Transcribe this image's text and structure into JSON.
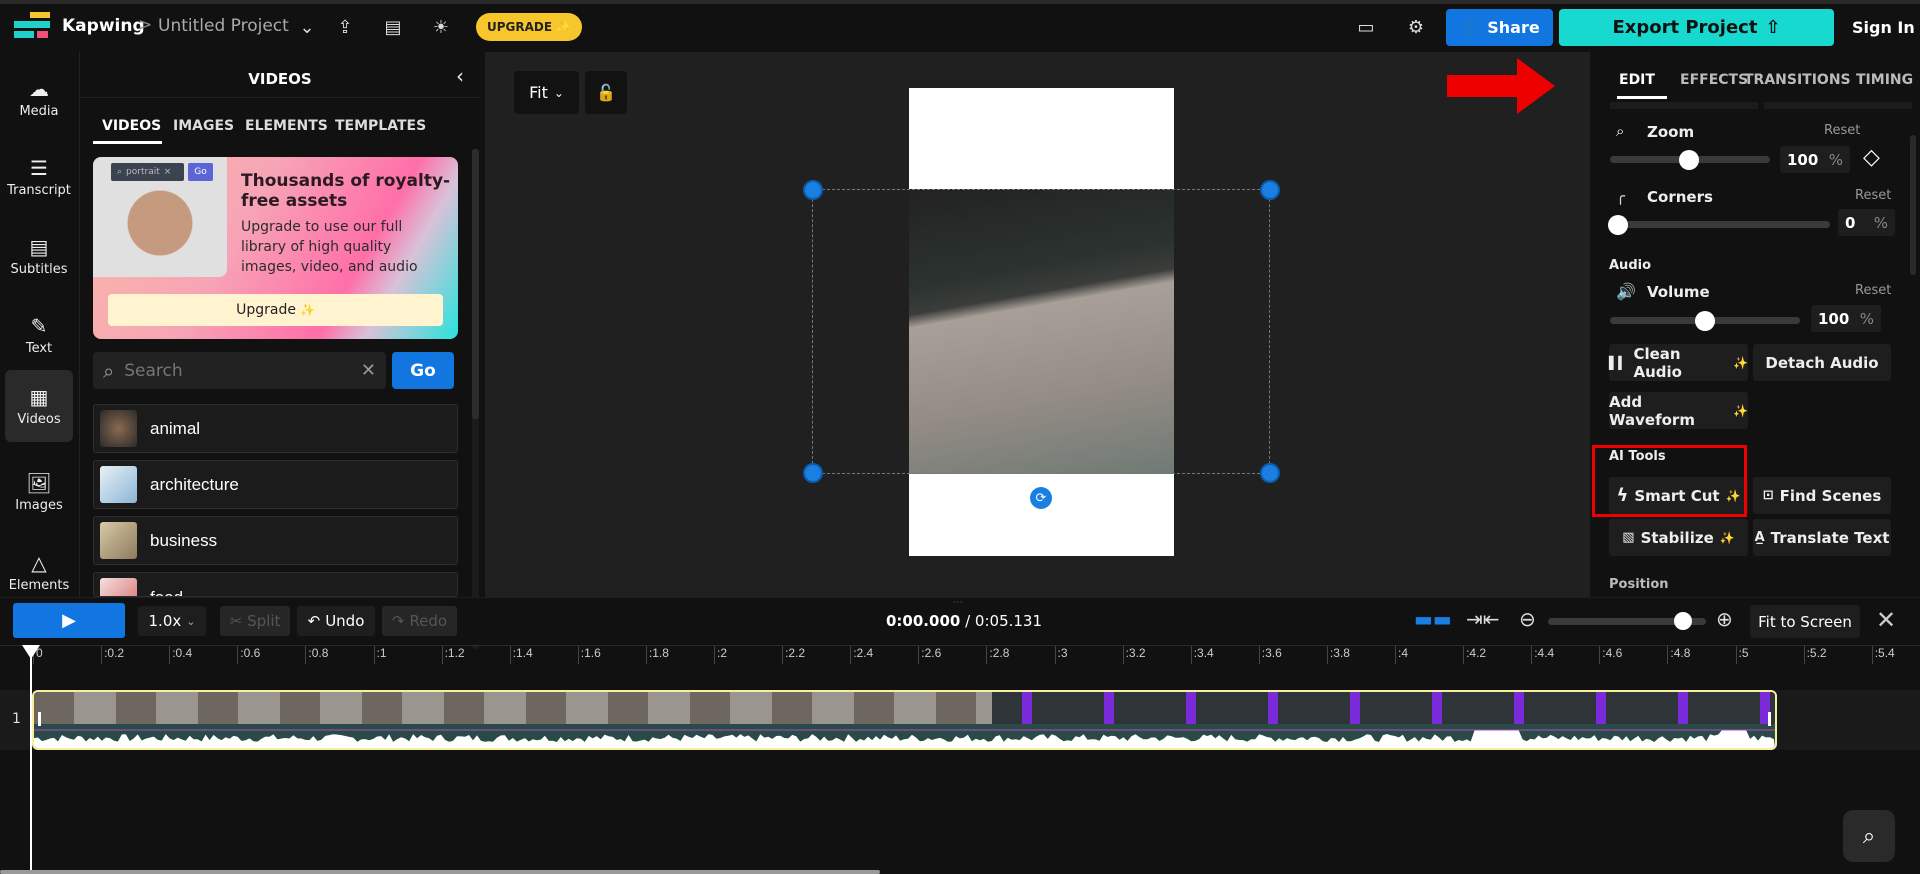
{
  "topbar": {
    "brand": "Kapwing",
    "separator": ">",
    "project_title": "Untitled Project",
    "upgrade_label": "UPGRADE",
    "share_label": "Share",
    "export_label": "Export Project",
    "signin_label": "Sign In",
    "icons": [
      "chevron-down-icon",
      "upload-icon",
      "captions-icon",
      "lightbulb-icon",
      "comment-icon",
      "gear-icon"
    ]
  },
  "rail": {
    "items": [
      {
        "label": "Media",
        "icon": "cloud-upload-icon"
      },
      {
        "label": "Transcript",
        "icon": "transcript-icon"
      },
      {
        "label": "Subtitles",
        "icon": "subtitles-icon"
      },
      {
        "label": "Text",
        "icon": "text-edit-icon"
      },
      {
        "label": "Videos",
        "icon": "film-icon",
        "active": true
      },
      {
        "label": "Images",
        "icon": "image-icon"
      },
      {
        "label": "Elements",
        "icon": "shapes-icon"
      }
    ]
  },
  "media_panel": {
    "title": "VIDEOS",
    "tabs": [
      "VIDEOS",
      "IMAGES",
      "ELEMENTS",
      "TEMPLATES"
    ],
    "active_tab": "VIDEOS",
    "promo": {
      "search_value": "portrait",
      "go": "Go",
      "headline": "Thousands of royalty-free assets",
      "body": "Upgrade to use our full library of high quality images, video, and audio",
      "button": "Upgrade"
    },
    "search": {
      "placeholder": "Search",
      "value": "",
      "go_label": "Go"
    },
    "categories": [
      "animal",
      "architecture",
      "business",
      "food"
    ]
  },
  "canvas": {
    "fit_label": "Fit"
  },
  "right_panel": {
    "tabs": [
      "EDIT",
      "EFFECTS",
      "TRANSITIONS",
      "TIMING"
    ],
    "active_tab": "EDIT",
    "zoom": {
      "label": "Zoom",
      "reset": "Reset",
      "value": "100",
      "unit": "%",
      "slider_fraction": 0.5
    },
    "corners": {
      "label": "Corners",
      "reset": "Reset",
      "value": "0",
      "unit": "%",
      "slider_fraction": 0
    },
    "audio_section": "Audio",
    "volume": {
      "label": "Volume",
      "reset": "Reset",
      "value": "100",
      "unit": "%",
      "slider_fraction": 0.5
    },
    "audio_buttons": [
      "Clean Audio",
      "Detach Audio",
      "Add Waveform"
    ],
    "ai_section": "AI Tools",
    "ai_buttons": [
      "Smart Cut",
      "Find Scenes",
      "Stabilize",
      "Translate Text"
    ],
    "position_section": "Position"
  },
  "timeline": {
    "speed": "1.0x",
    "split": "Split",
    "undo": "Undo",
    "redo": "Redo",
    "current_time": "0:00.000",
    "total_time": "/ 0:05.131",
    "fit_to_screen": "Fit to Screen",
    "zoom_fraction": 0.88,
    "track_number": "1",
    "ticks": [
      "0",
      ":0.2",
      ":0.4",
      ":0.6",
      ":0.8",
      ":1",
      ":1.2",
      ":1.4",
      ":1.6",
      ":1.8",
      ":2",
      ":2.2",
      ":2.4",
      ":2.6",
      ":2.8",
      ":3",
      ":3.2",
      ":3.4",
      ":3.6",
      ":3.8",
      ":4",
      ":4.2",
      ":4.4",
      ":4.6",
      ":4.8",
      ":5",
      ":5.2",
      ":5.4"
    ]
  },
  "colors": {
    "accent_blue": "#1176e0",
    "export_teal": "#18d9d0",
    "upgrade_yellow": "#f7c52c",
    "annotation_red": "#ee0000"
  }
}
